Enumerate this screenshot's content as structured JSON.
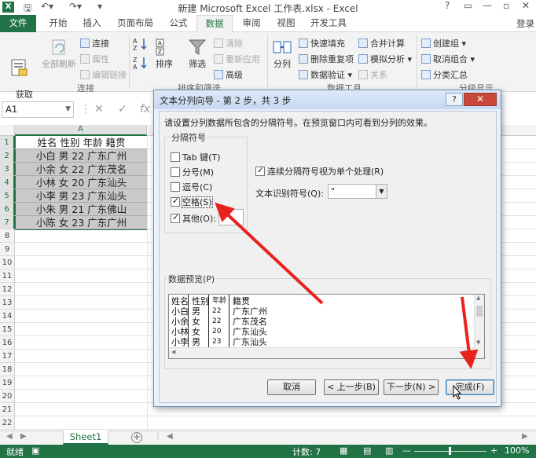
{
  "window": {
    "app_logo": "X",
    "title": "新建 Microsoft Excel 工作表.xlsx - Excel",
    "controls": [
      "?",
      "▭",
      "—",
      "▫",
      "✕"
    ],
    "login": "登录"
  },
  "quick_access": [
    "save-icon",
    "undo-icon",
    "redo-icon"
  ],
  "tabs": [
    {
      "label": "文件"
    },
    {
      "label": "开始"
    },
    {
      "label": "插入"
    },
    {
      "label": "页面布局"
    },
    {
      "label": "公式"
    },
    {
      "label": "数据",
      "active": true
    },
    {
      "label": "审阅"
    },
    {
      "label": "视图"
    },
    {
      "label": "开发工具"
    }
  ],
  "ribbon": {
    "get_external": "获取\n外部数据 ▾",
    "refresh_all": "全部刷新",
    "connections": "连接",
    "properties": "属性",
    "edit_links": "编辑链接",
    "group_connections": "连接",
    "sort_az_icon": "sort-az-icon",
    "sort": "排序",
    "filter": "筛选",
    "clear": "清除",
    "reapply": "重新应用",
    "advanced": "高级",
    "group_sort_filter": "排序和筛选",
    "text_to_columns": "分列",
    "flash_fill": "快速填充",
    "remove_duplicates": "删除重复项",
    "data_validation": "数据验证 ▾",
    "consolidate": "合并计算",
    "what_if": "模拟分析 ▾",
    "relationships": "关系",
    "group_data_tools": "数据工具",
    "group": "创建组 ▾",
    "ungroup": "取消组合 ▾",
    "subtotal": "分类汇总",
    "group_outline": "分级显示"
  },
  "formula_bar": {
    "name_box": "A1",
    "cancel": "✕",
    "enter": "✓",
    "fx": "fx"
  },
  "sheet": {
    "column_header": "A",
    "rows": [
      {
        "num": "1",
        "value": "姓名 性别 年龄 籍贯"
      },
      {
        "num": "2",
        "value": "小白 男 22 广东广州"
      },
      {
        "num": "3",
        "value": "小余 女 22 广东茂名"
      },
      {
        "num": "4",
        "value": "小林 女 20 广东汕头"
      },
      {
        "num": "5",
        "value": "小李 男 23 广东汕头"
      },
      {
        "num": "6",
        "value": "小朱 男 21 广东佛山"
      },
      {
        "num": "7",
        "value": "小陈 女 23 广东广州"
      }
    ],
    "empty_rows": [
      "8",
      "9",
      "10",
      "11",
      "12",
      "13",
      "14",
      "15",
      "16",
      "17",
      "18",
      "19",
      "20",
      "21",
      "22"
    ]
  },
  "sheet_tabs": {
    "active": "Sheet1",
    "add": "+"
  },
  "status_bar": {
    "count": "计数: 7",
    "zoom": "100%",
    "zoom_minus": "—",
    "zoom_plus": "+",
    "zoom_level": 0.5
  },
  "dialog": {
    "title": "文本分列向导 - 第 2 步，共 3 步",
    "help": "?",
    "close": "✕",
    "description": "请设置分列数据所包含的分隔符号。在预览窗口内可看到分列的效果。",
    "delimiters_legend": "分隔符号",
    "delimiters": [
      {
        "label": "Tab 键(T)",
        "checked": false
      },
      {
        "label": "分号(M)",
        "checked": false
      },
      {
        "label": "逗号(C)",
        "checked": false
      },
      {
        "label": "空格(S)",
        "checked": true
      },
      {
        "label": "其他(O):",
        "checked": true
      }
    ],
    "consecutive_label": "连续分隔符号视为单个处理(R)",
    "consecutive_checked": true,
    "qualifier_label": "文本识别符号(Q):",
    "qualifier_value": "\"",
    "preview_legend": "数据预览(P)",
    "preview_rows": [
      [
        "姓名",
        "性别",
        "年龄",
        "籍贯"
      ],
      [
        "小白",
        "男",
        "22",
        "广东广州"
      ],
      [
        "小余",
        "女",
        "22",
        "广东茂名"
      ],
      [
        "小林",
        "女",
        "20",
        "广东汕头"
      ],
      [
        "小李",
        "男",
        "23",
        "广东汕头"
      ]
    ],
    "buttons": {
      "cancel": "取消",
      "back": "< 上一步(B)",
      "next": "下一步(N) >",
      "finish": "完成(F)"
    }
  },
  "colors": {
    "excel_green": "#217346",
    "annotation_red": "#e8231f",
    "selection_fill": "#c9c9c9",
    "dialog_close": "#c9473a"
  }
}
